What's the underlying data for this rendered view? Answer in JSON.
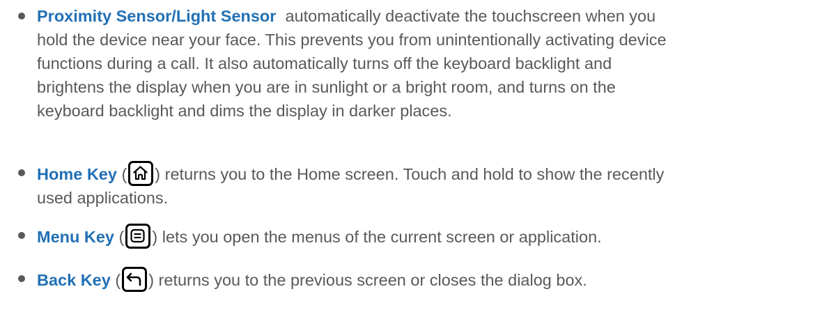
{
  "items": [
    {
      "term": "Proximity Sensor/Light Sensor",
      "lines": [
        "automatically deactivate the touchscreen when you",
        "hold the device near your face. This prevents you from unintentionally activating device",
        "functions during a call. It also automatically turns off the keyboard backlight and",
        "brightens the display when you are in sunlight or a bright room, and turns on the",
        "keyboard backlight and dims the display in darker places."
      ]
    },
    {
      "term": "Home Key",
      "icon": "home-icon",
      "open": " (",
      "close": ")",
      "text1": "returns you to the Home screen. Touch and hold to show the recently",
      "text2": "used applications."
    },
    {
      "term": "Menu Key",
      "icon": "menu-icon",
      "open": " (",
      "close": ")",
      "text1": "lets you open the menus of the current screen or application."
    },
    {
      "term": "Back Key",
      "icon": "back-icon",
      "open": " (",
      "close": ")",
      "text1": "returns you to the previous screen or closes the dialog box."
    }
  ],
  "colors": {
    "term": "#2270b4",
    "text": "#595959",
    "icon_border": "#000000"
  }
}
